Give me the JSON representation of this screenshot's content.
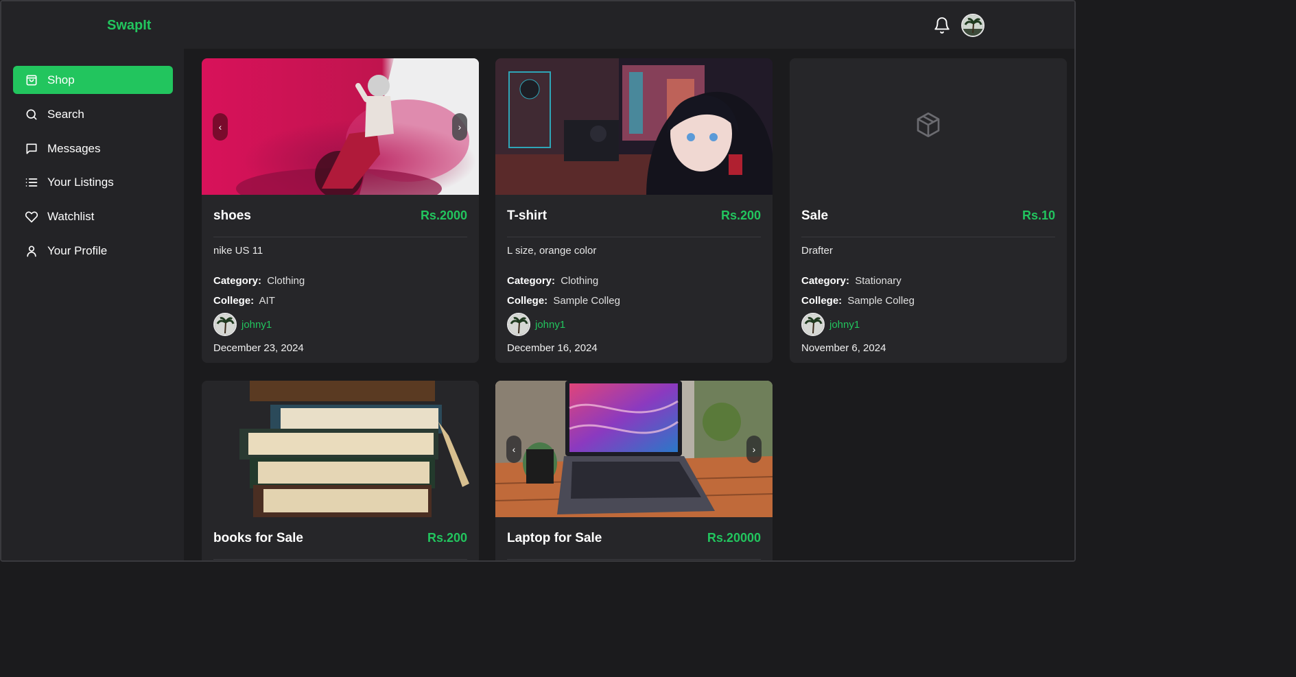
{
  "app": {
    "title": "SwapIt"
  },
  "header": {
    "notifications_icon": "bell-icon",
    "avatar_icon": "user-avatar"
  },
  "sidebar": {
    "items": [
      {
        "label": "Shop",
        "icon": "shopping-bag-icon",
        "active": true
      },
      {
        "label": "Search",
        "icon": "search-icon",
        "active": false
      },
      {
        "label": "Messages",
        "icon": "message-icon",
        "active": false
      },
      {
        "label": "Your Listings",
        "icon": "list-icon",
        "active": false
      },
      {
        "label": "Watchlist",
        "icon": "heart-icon",
        "active": false
      },
      {
        "label": "Your Profile",
        "icon": "user-icon",
        "active": false
      }
    ]
  },
  "labels": {
    "category": "Category:",
    "college": "College:"
  },
  "listings": [
    {
      "title": "shoes",
      "price": "Rs.2000",
      "description": "nike US 11",
      "category": "Clothing",
      "college": "AIT",
      "seller": "johny1",
      "date": "December 23, 2024",
      "prev": "‹",
      "next": "›"
    },
    {
      "title": "T-shirt",
      "price": "Rs.200",
      "description": "L size, orange color",
      "category": "Clothing",
      "college": "Sample Colleg",
      "seller": "johny1",
      "date": "December 16, 2024"
    },
    {
      "title": "Sale",
      "price": "Rs.10",
      "description": "Drafter",
      "category": "Stationary",
      "college": "Sample Colleg",
      "seller": "johny1",
      "date": "November 6, 2024"
    },
    {
      "title": "books for Sale",
      "price": "Rs.200"
    },
    {
      "title": "Laptop for Sale",
      "price": "Rs.20000",
      "prev": "‹",
      "next": "›"
    }
  ],
  "colors": {
    "accent": "#22c55e",
    "background": "#1b1b1d",
    "panel": "#232326",
    "card": "#262629"
  }
}
